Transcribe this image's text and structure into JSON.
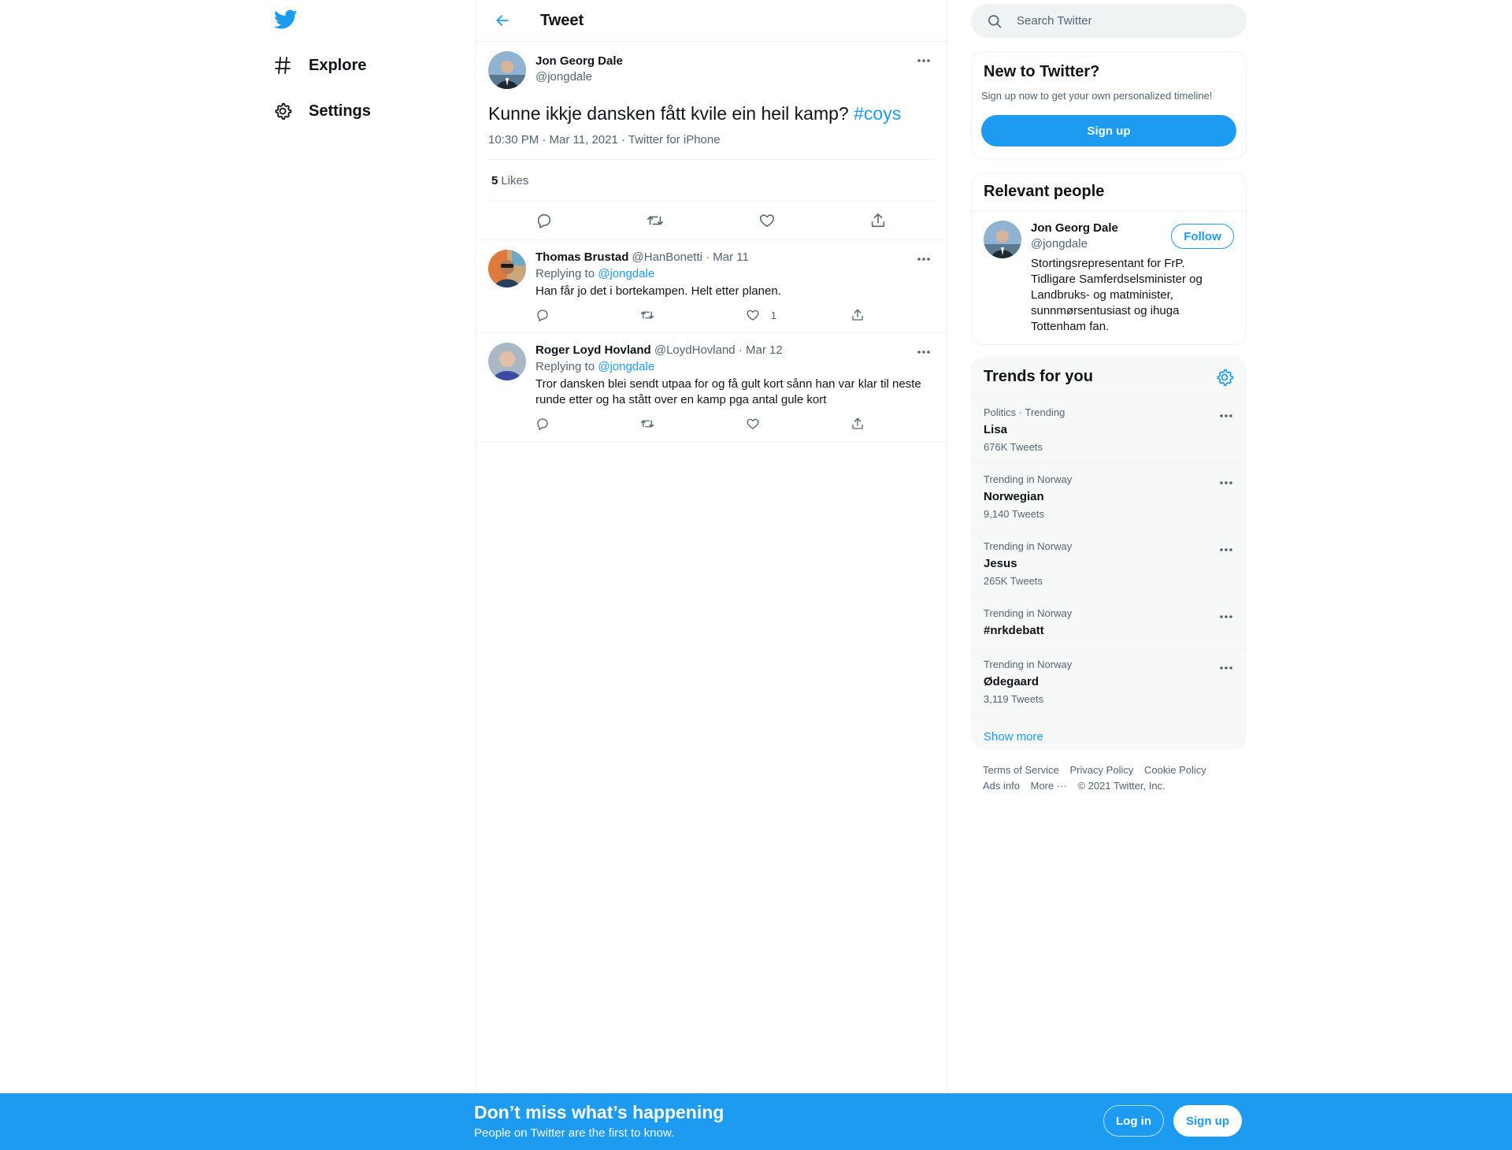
{
  "colors": {
    "accent": "#1d9bf0",
    "text_primary": "#0f1419",
    "text_secondary": "#536471",
    "border": "#eff3f4",
    "card_bg": "#f7f9f9"
  },
  "nav": {
    "logo_icon": "twitter-bird-icon",
    "items": [
      {
        "label": "Explore",
        "icon": "hashtag-icon"
      },
      {
        "label": "Settings",
        "icon": "gear-icon"
      }
    ]
  },
  "header": {
    "back_icon": "arrow-left-icon",
    "title": "Tweet"
  },
  "tweet": {
    "author_name": "Jon Georg Dale",
    "author_handle": "@jongdale",
    "text": "Kunne ikkje dansken fått kvile ein heil kamp?",
    "hashtag": "#coys",
    "meta": "10:30 PM · Mar 11, 2021 · Twitter for iPhone",
    "likes_count": "5",
    "likes_label": "Likes",
    "actions": [
      "reply-icon",
      "retweet-icon",
      "like-icon",
      "share-icon"
    ]
  },
  "replies": [
    {
      "name": "Thomas Brustad",
      "meta": "@HanBonetti · Mar 11",
      "replying_prefix": "Replying to",
      "replying_to": "@jongdale",
      "text": "Han får jo det i bortekampen. Helt etter planen.",
      "like_count": "1"
    },
    {
      "name": "Roger Loyd Hovland",
      "meta": "@LoydHovland · Mar 12",
      "replying_prefix": "Replying to",
      "replying_to": "@jongdale",
      "text": "Tror dansken blei sendt utpaa for og få gult kort sånn han var klar til neste runde etter og ha stått over en kamp pga antal gule kort",
      "like_count": ""
    }
  ],
  "search": {
    "placeholder": "Search Twitter"
  },
  "new_to_twitter": {
    "title": "New to Twitter?",
    "subtitle": "Sign up now to get your own personalized timeline!",
    "signup_label": "Sign up"
  },
  "relevant_people": {
    "title": "Relevant people",
    "person": {
      "name": "Jon Georg Dale",
      "handle": "@jongdale",
      "follow_label": "Follow",
      "bio": "Stortingsrepresentant for FrP. Tidligare Samferdselsminister og Landbruks- og matminister, sunnmørsentusiast og ihuga Tottenham fan."
    }
  },
  "trends": {
    "title": "Trends for you",
    "items": [
      {
        "context": "Politics · Trending",
        "name": "Lisa",
        "count": "676K Tweets"
      },
      {
        "context": "Trending in Norway",
        "name": "Norwegian",
        "count": "9,140 Tweets"
      },
      {
        "context": "Trending in Norway",
        "name": "Jesus",
        "count": "265K Tweets"
      },
      {
        "context": "Trending in Norway",
        "name": "#nrkdebatt",
        "count": ""
      },
      {
        "context": "Trending in Norway",
        "name": "Ødegaard",
        "count": "3,119 Tweets"
      }
    ],
    "show_more": "Show more"
  },
  "footer": {
    "terms": "Terms of Service",
    "privacy": "Privacy Policy",
    "cookie": "Cookie Policy",
    "ads": "Ads info",
    "more": "More ···",
    "copyright": "© 2021 Twitter, Inc."
  },
  "bottom_bar": {
    "title": "Don’t miss what’s happening",
    "subtitle": "People on Twitter are the first to know.",
    "login_label": "Log in",
    "signup_label": "Sign up"
  }
}
